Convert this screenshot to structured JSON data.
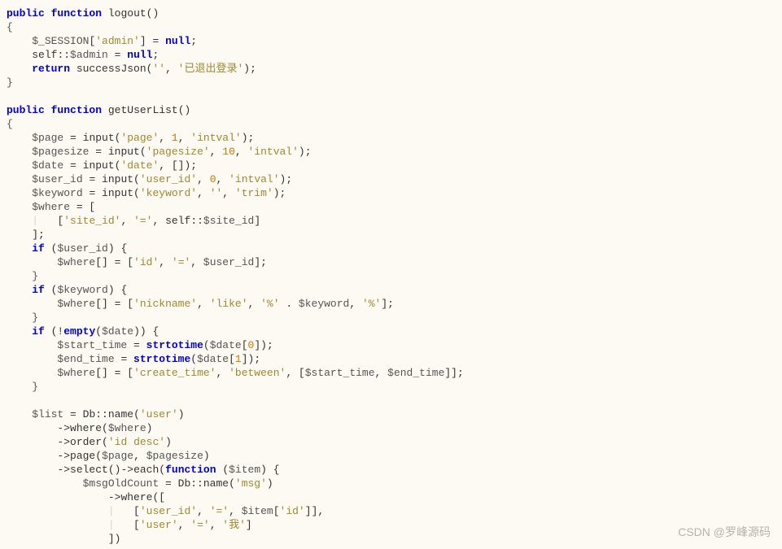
{
  "code": {
    "fn1_sig": {
      "kw1": "public",
      "kw2": "function",
      "name": "logout",
      "paren": "()"
    },
    "fn1_b1": {
      "text": "$_SESSION",
      "idx": "'admin'",
      "eq": " = ",
      "kw": "null",
      "semi": ";"
    },
    "fn1_b2": {
      "self": "self",
      "dbl": "::",
      "prop": "$admin",
      "eq": " = ",
      "kw": "null",
      "semi": ";"
    },
    "fn1_b3": {
      "kw": "return",
      "call": " successJson(",
      "s1": "''",
      "c": ", ",
      "s2": "'已退出登录'",
      "end": ");"
    },
    "fn2_sig": {
      "kw1": "public",
      "kw2": "function",
      "name": "getUserList",
      "paren": "()"
    },
    "l_page": {
      "v": "$page",
      "eq": " = input(",
      "s": "'page'",
      "c1": ", ",
      "n": "1",
      "c2": ", ",
      "s2": "'intval'",
      "end": ");"
    },
    "l_psize": {
      "v": "$pagesize",
      "eq": " = input(",
      "s": "'pagesize'",
      "c1": ", ",
      "n": "10",
      "c2": ", ",
      "s2": "'intval'",
      "end": ");"
    },
    "l_date": {
      "v": "$date",
      "eq": " = input(",
      "s": "'date'",
      "c": ", []);"
    },
    "l_uid": {
      "v": "$user_id",
      "eq": " = input(",
      "s": "'user_id'",
      "c1": ", ",
      "n": "0",
      "c2": ", ",
      "s2": "'intval'",
      "end": ");"
    },
    "l_kw": {
      "v": "$keyword",
      "eq": " = input(",
      "s": "'keyword'",
      "c1": ", ",
      "s1": "''",
      "c2": ", ",
      "s2": "'trim'",
      "end": ");"
    },
    "l_where": {
      "v": "$where",
      "eq": " = ["
    },
    "l_where1": {
      "open": "[",
      "s1": "'site_id'",
      "c1": ", ",
      "s2": "'='",
      "c2": ", ",
      "self": "self",
      "dbl": "::",
      "prop": "$site_id",
      "close": "]"
    },
    "l_where_c": "];",
    "if_uid": {
      "kw": "if",
      "open": " (",
      "v": "$user_id",
      "close": ") {"
    },
    "if_uid_b": {
      "v": "$where",
      "idx": "[]",
      "eq": " = [",
      "s1": "'id'",
      "c1": ", ",
      "s2": "'='",
      "c2": ", ",
      "v2": "$user_id",
      "close": "];"
    },
    "if_kw": {
      "kw": "if",
      "open": " (",
      "v": "$keyword",
      "close": ") {"
    },
    "if_kw_b": {
      "v": "$where",
      "idx": "[]",
      "eq": " = [",
      "s1": "'nickname'",
      "c1": ", ",
      "s2": "'like'",
      "c2": ", ",
      "s3": "'%'",
      "dot": " . ",
      "v2": "$keyword",
      "c3": ", ",
      "s4": "'%'",
      "close": "];"
    },
    "if_date": {
      "kw": "if",
      "open": " (!",
      "fn": "empty",
      "po": "(",
      "v": "$date",
      "close": ")) {"
    },
    "st_time": {
      "v": "$start_time",
      "eq": " = ",
      "fn": "strtotime",
      "po": "(",
      "v2": "$date",
      "idx_o": "[",
      "n": "0",
      "idx_c": "]",
      "close": ");"
    },
    "en_time": {
      "v": "$end_time",
      "eq": " = ",
      "fn": "strtotime",
      "po": "(",
      "v2": "$date",
      "idx_o": "[",
      "n": "1",
      "idx_c": "]",
      "close": ");"
    },
    "where_bt": {
      "v": "$where",
      "idx": "[]",
      "eq": " = [",
      "s1": "'create_time'",
      "c1": ", ",
      "s2": "'between'",
      "c2": ", [",
      "v1": "$start_time",
      "c3": ", ",
      "v2": "$end_time",
      "close": "]];"
    },
    "list": {
      "v": "$list",
      "eq": " = Db::",
      "fn": "name",
      "po": "(",
      "s": "'user'",
      "close": ")"
    },
    "chain_w": {
      "arrow": "->",
      "fn": "where",
      "po": "(",
      "v": "$where",
      "close": ")"
    },
    "chain_o": {
      "arrow": "->",
      "fn": "order",
      "po": "(",
      "s": "'id desc'",
      "close": ")"
    },
    "chain_p": {
      "arrow": "->",
      "fn": "page",
      "po": "(",
      "v1": "$page",
      "c": ", ",
      "v2": "$pagesize",
      "close": ")"
    },
    "chain_s": {
      "arrow": "->",
      "fn1": "select",
      "p1": "()",
      "arrow2": "->",
      "fn2": "each",
      "po": "(",
      "kw": "function",
      "pa": " (",
      "v": "$item",
      "close": ") {"
    },
    "msg": {
      "v": "$msgOldCount",
      "eq": " = Db::",
      "fn": "name",
      "po": "(",
      "s": "'msg'",
      "close": ")"
    },
    "msg_w": {
      "arrow": "->",
      "fn": "where",
      "po": "(["
    },
    "msg_a1": {
      "open": "[",
      "s1": "'user_id'",
      "c1": ", ",
      "s2": "'='",
      "c2": ", ",
      "v": "$item",
      "idx_o": "[",
      "s3": "'id'",
      "idx_c": "]",
      "close": "],"
    },
    "msg_a2": {
      "open": "[",
      "s1": "'user'",
      "c1": ", ",
      "s2": "'='",
      "c2": ", ",
      "s3": "'我'",
      "close": "]"
    },
    "msg_wc": "])",
    "brace_o": "{",
    "brace_c": "}"
  },
  "watermark": "CSDN @罗峰源码"
}
